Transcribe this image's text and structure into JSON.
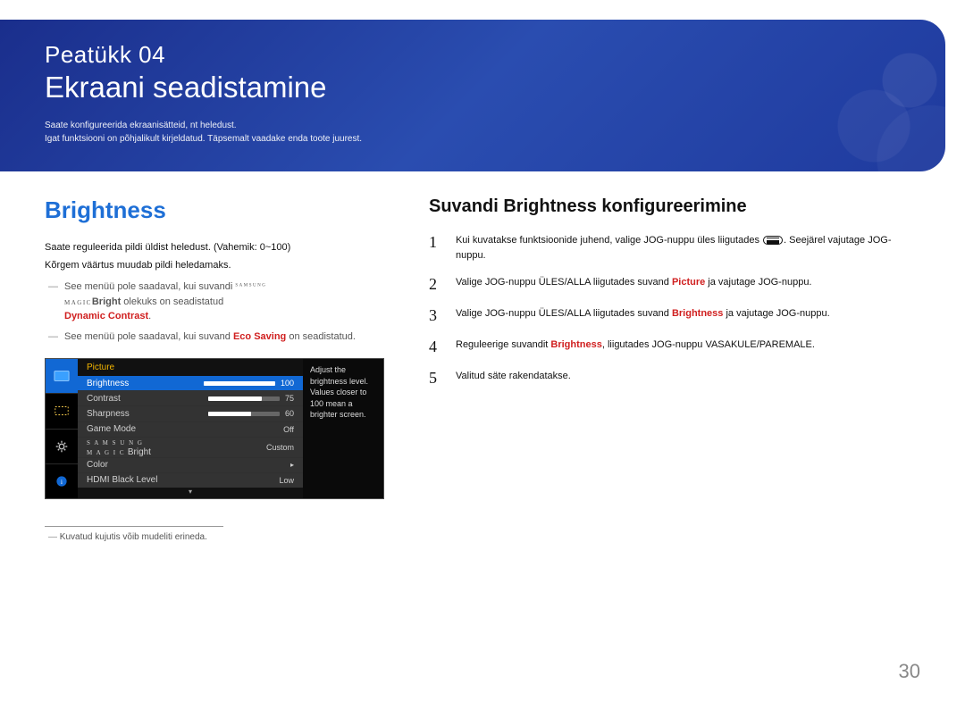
{
  "banner": {
    "chapter": "Peatükk  04",
    "title": "Ekraani seadistamine",
    "sub1": "Saate konfigureerida ekraanisätteid, nt heledust.",
    "sub2": "Igat funktsiooni on põhjalikult kirjeldatud. Täpsemalt vaadake enda toote juurest."
  },
  "left": {
    "heading": "Brightness",
    "p1": "Saate reguleerida pildi üldist heledust. (Vahemik: 0~100)",
    "p2": "Kõrgem väärtus muudab pildi heledamaks.",
    "note1_a": "See menüü pole saadaval, kui suvandi ",
    "note1_magic": "Bright",
    "note1_b": " olekuks on seadistatud ",
    "note1_c": "Dynamic Contrast",
    "note2_a": "See menüü pole saadaval, kui suvand ",
    "note2_b": "Eco Saving",
    "note2_c": " on seadistatud.",
    "footnote": "Kuvatud kujutis võib mudeliti erineda."
  },
  "osd": {
    "head": "Picture",
    "rows": [
      {
        "label": "Brightness",
        "value": "100",
        "bar": 100,
        "active": true
      },
      {
        "label": "Contrast",
        "value": "75",
        "bar": 75
      },
      {
        "label": "Sharpness",
        "value": "60",
        "bar": 60
      },
      {
        "label": "Game Mode",
        "value": "Off"
      },
      {
        "label": "MAGICBright",
        "magic": true,
        "value": "Custom"
      },
      {
        "label": "Color",
        "value": "",
        "tri": true
      },
      {
        "label": "HDMI Black Level",
        "value": "Low"
      }
    ],
    "tip": "Adjust the brightness level. Values closer to 100 mean a brighter screen."
  },
  "right": {
    "heading": "Suvandi Brightness konfigureerimine",
    "steps": [
      {
        "n": "1",
        "pre": "Kui kuvatakse funktsioonide juhend, valige JOG-nuppu üles liigutades",
        "icon": true,
        "post": ". Seejärel vajutage JOG-nuppu."
      },
      {
        "n": "2",
        "pre": "Valige JOG-nuppu ÜLES/ALLA liigutades suvand ",
        "hl": "Picture",
        "post": " ja vajutage JOG-nuppu."
      },
      {
        "n": "3",
        "pre": "Valige JOG-nuppu ÜLES/ALLA liigutades suvand ",
        "hl": "Brightness",
        "post": " ja vajutage JOG-nuppu."
      },
      {
        "n": "4",
        "pre": "Reguleerige suvandit ",
        "hl": "Brightness",
        "post": ", liigutades JOG-nuppu VASAKULE/PAREMALE."
      },
      {
        "n": "5",
        "pre": "Valitud säte rakendatakse."
      }
    ]
  },
  "page_number": "30"
}
